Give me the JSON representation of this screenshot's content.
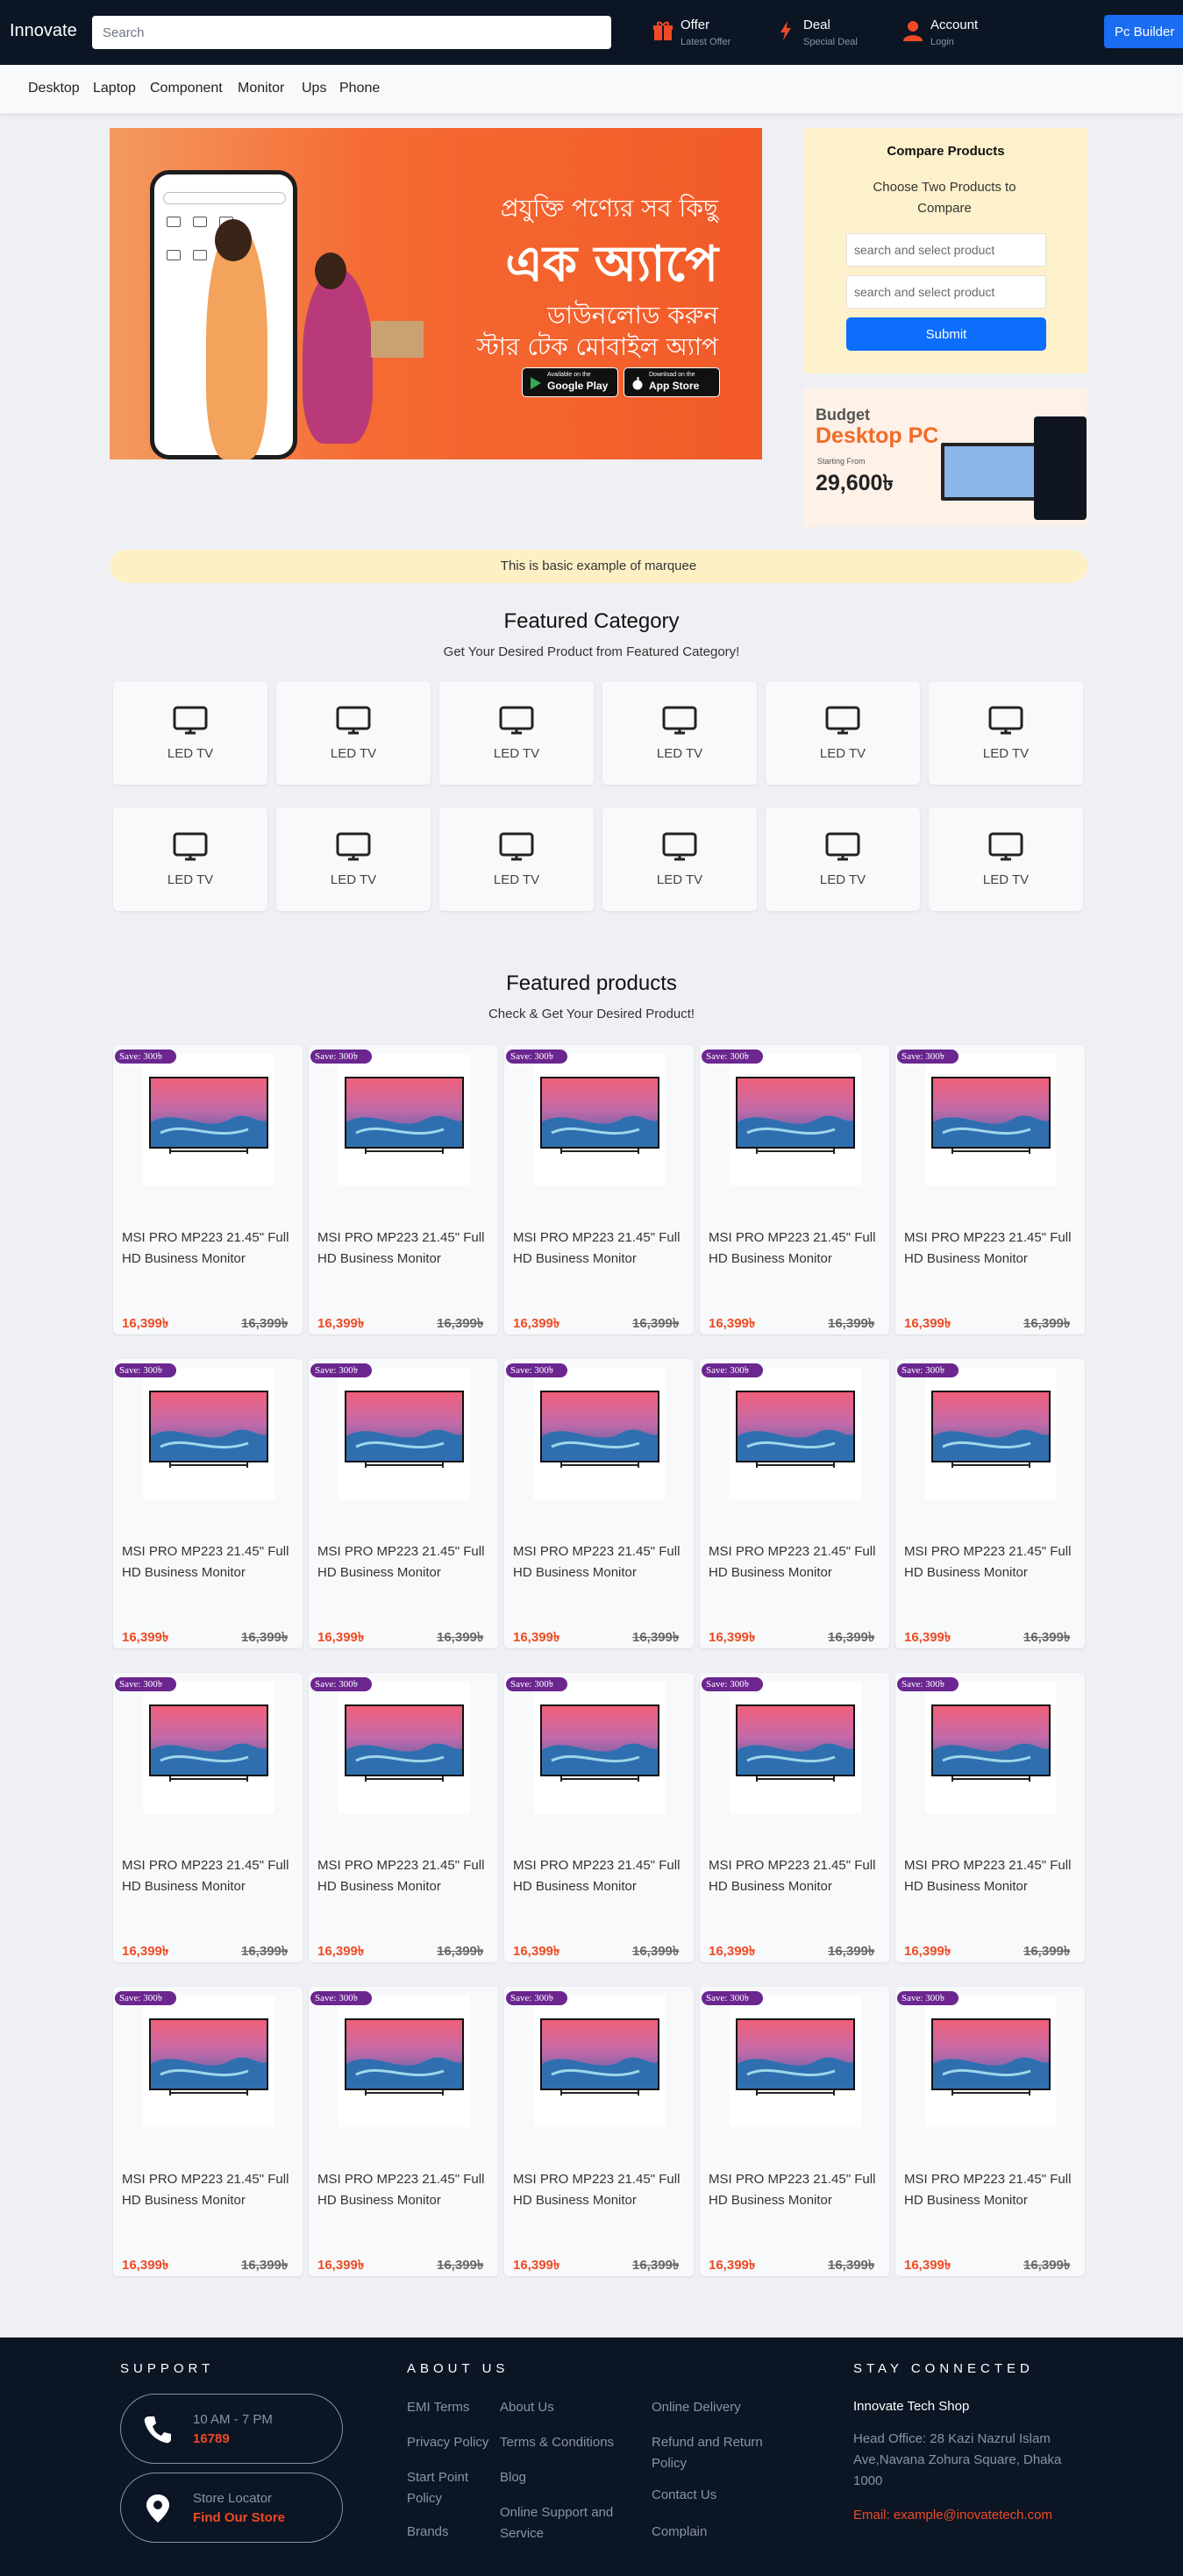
{
  "header": {
    "brand": "Innovate",
    "search_placeholder": "Search",
    "offer": {
      "title": "Offer",
      "sub": "Latest Offer"
    },
    "deal": {
      "title": "Deal",
      "sub": "Special Deal"
    },
    "account": {
      "title": "Account",
      "sub": "Login"
    },
    "pc_builder": "Pc Builder"
  },
  "nav": [
    "Desktop",
    "Laptop",
    "Component",
    "Monitor",
    "Ups",
    "Phone"
  ],
  "banner": {
    "line1": "প্রযুক্তি পণ্যের সব কিছু",
    "line2": "এক অ্যাপে",
    "line3": "ডাউনলোড করুন",
    "line4": "স্টার টেক মোবাইল অ্যাপ",
    "google_small": "Available on the",
    "google": "Google Play",
    "apple_small": "Download on the",
    "apple": "App Store"
  },
  "compare": {
    "title": "Compare Products",
    "subtitle": "Choose Two Products to Compare",
    "placeholder1": "search and select product",
    "placeholder2": "search and select product",
    "submit": "Submit"
  },
  "promo": {
    "line1": "Budget",
    "line2": "Desktop PC",
    "line3": "Starting From",
    "price": "29,600৳"
  },
  "marquee": "This is basic example of marquee",
  "featured_category": {
    "title": "Featured Category",
    "subtitle": "Get Your Desired Product from Featured Category!",
    "items": [
      "LED TV",
      "LED TV",
      "LED TV",
      "LED TV",
      "LED TV",
      "LED TV",
      "LED TV",
      "LED TV",
      "LED TV",
      "LED TV",
      "LED TV",
      "LED TV"
    ]
  },
  "featured_products": {
    "title": "Featured products",
    "subtitle": "Check & Get Your Desired Product!",
    "product": {
      "badge": "Save: 300৳",
      "name": "MSI PRO MP223 21.45\" Full HD Business Monitor",
      "price": "16,399৳",
      "old_price": "16,399৳"
    },
    "count": 20
  },
  "footer": {
    "support_title": "SUPPORT",
    "hours": "10 AM - 7 PM",
    "phone": "16789",
    "locator": "Store Locator",
    "find_store": "Find Our Store",
    "about_title": "ABOUT US",
    "links_col1": [
      "EMI Terms",
      "Privacy Policy",
      "Start Point Policy",
      "Brands"
    ],
    "links_col2": [
      "About Us",
      "Terms & Conditions",
      "Blog",
      "Online Support and Service"
    ],
    "links_col3": [
      "Online Delivery",
      "Refund and Return Policy",
      "Contact Us",
      "Complain"
    ],
    "connected_title": "STAY CONNECTED",
    "shop_name": "Innovate Tech Shop",
    "address": "Head Office: 28 Kazi Nazrul Islam Ave,Navana Zohura Square, Dhaka 1000",
    "email": "Email: example@inovatetech.com"
  },
  "colors": {
    "accent": "#ef4a23",
    "nav_bg": "#0b1524",
    "primary": "#0d6efd",
    "badge": "#6b2690"
  }
}
